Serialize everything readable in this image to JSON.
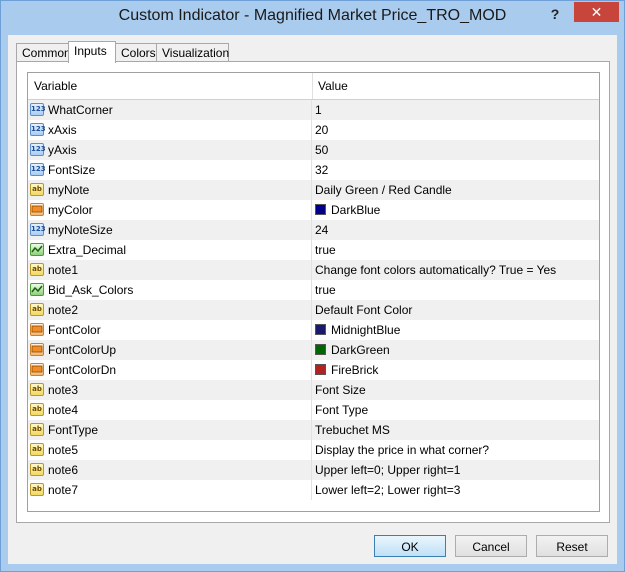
{
  "window": {
    "title": "Custom Indicator - Magnified Market Price_TRO_MOD",
    "help_glyph": "?",
    "close_glyph": "✕"
  },
  "tabs": [
    {
      "label": "Common",
      "active": false
    },
    {
      "label": "Inputs",
      "active": true
    },
    {
      "label": "Colors",
      "active": false
    },
    {
      "label": "Visualization",
      "active": false
    }
  ],
  "grid": {
    "columns": {
      "variable": "Variable",
      "value": "Value"
    },
    "rows": [
      {
        "type": "int",
        "icon": "123",
        "variable": "WhatCorner",
        "value": "1"
      },
      {
        "type": "int",
        "icon": "123",
        "variable": "xAxis",
        "value": "20"
      },
      {
        "type": "int",
        "icon": "123",
        "variable": "yAxis",
        "value": "50"
      },
      {
        "type": "int",
        "icon": "123",
        "variable": "FontSize",
        "value": "32"
      },
      {
        "type": "str",
        "icon": "ab",
        "variable": "myNote",
        "value": "Daily Green / Red Candle"
      },
      {
        "type": "col",
        "icon": "",
        "variable": "myColor",
        "value": "DarkBlue",
        "color": "#00008b"
      },
      {
        "type": "int",
        "icon": "123",
        "variable": "myNoteSize",
        "value": "24"
      },
      {
        "type": "bool",
        "icon": "",
        "variable": "Extra_Decimal",
        "value": "true"
      },
      {
        "type": "str",
        "icon": "ab",
        "variable": "note1",
        "value": "Change font colors automatically? True = Yes"
      },
      {
        "type": "bool",
        "icon": "",
        "variable": "Bid_Ask_Colors",
        "value": "true"
      },
      {
        "type": "str",
        "icon": "ab",
        "variable": "note2",
        "value": "Default Font Color"
      },
      {
        "type": "col",
        "icon": "",
        "variable": "FontColor",
        "value": "MidnightBlue",
        "color": "#191970"
      },
      {
        "type": "col",
        "icon": "",
        "variable": "FontColorUp",
        "value": "DarkGreen",
        "color": "#006400"
      },
      {
        "type": "col",
        "icon": "",
        "variable": "FontColorDn",
        "value": "FireBrick",
        "color": "#b22222"
      },
      {
        "type": "str",
        "icon": "ab",
        "variable": "note3",
        "value": "Font Size"
      },
      {
        "type": "str",
        "icon": "ab",
        "variable": "note4",
        "value": "Font Type"
      },
      {
        "type": "str",
        "icon": "ab",
        "variable": "FontType",
        "value": "Trebuchet MS"
      },
      {
        "type": "str",
        "icon": "ab",
        "variable": "note5",
        "value": "Display the price in what corner?"
      },
      {
        "type": "str",
        "icon": "ab",
        "variable": "note6",
        "value": "Upper left=0; Upper right=1"
      },
      {
        "type": "str",
        "icon": "ab",
        "variable": "note7",
        "value": "Lower left=2; Lower right=3"
      }
    ]
  },
  "buttons": {
    "ok": "OK",
    "cancel": "Cancel",
    "reset": "Reset"
  }
}
